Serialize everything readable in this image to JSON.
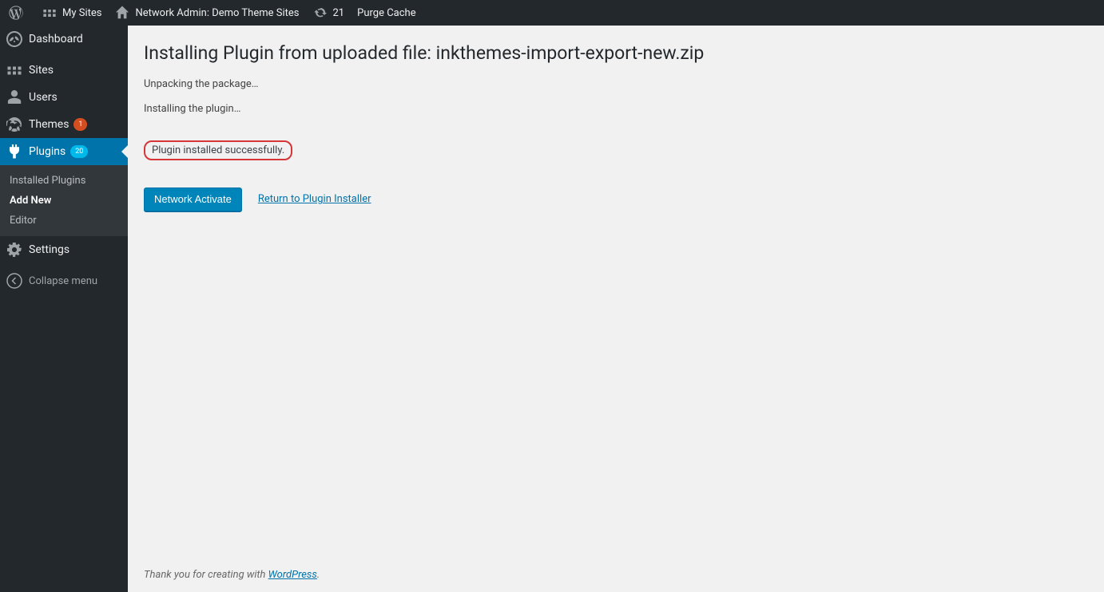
{
  "adminbar": {
    "mysites": "My Sites",
    "network": "Network Admin: Demo Theme Sites",
    "updates_count": "21",
    "purge_cache": "Purge Cache"
  },
  "sidebar": {
    "dashboard": "Dashboard",
    "sites": "Sites",
    "users": "Users",
    "themes": "Themes",
    "themes_badge": "1",
    "plugins": "Plugins",
    "plugins_badge": "20",
    "settings": "Settings",
    "collapse": "Collapse menu",
    "sub": {
      "installed": "Installed Plugins",
      "add_new": "Add New",
      "editor": "Editor"
    }
  },
  "content": {
    "title": "Installing Plugin from uploaded file: inkthemes-import-export-new.zip",
    "status_unpacking": "Unpacking the package…",
    "status_installing": "Installing the plugin…",
    "status_success": "Plugin installed successfully.",
    "activate_button": "Network Activate",
    "return_link": "Return to Plugin Installer"
  },
  "footer": {
    "text": "Thank you for creating with ",
    "link": "WordPress",
    "period": "."
  }
}
